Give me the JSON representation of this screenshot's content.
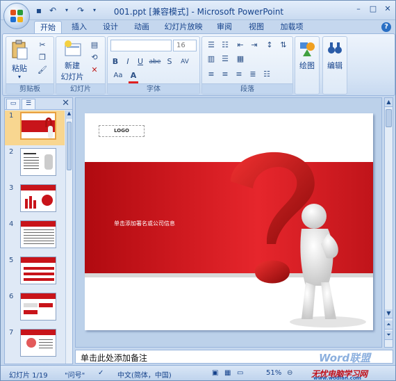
{
  "window": {
    "title": "001.ppt [兼容模式] - Microsoft PowerPoint"
  },
  "qat": [
    "save-icon",
    "undo-icon",
    "dropdown-icon",
    "redo-icon",
    "customize-icon"
  ],
  "tabs": [
    "开始",
    "插入",
    "设计",
    "动画",
    "幻灯片放映",
    "审阅",
    "视图",
    "加载项"
  ],
  "active_tab": "开始",
  "ribbon": {
    "clipboard": {
      "label": "剪贴板",
      "paste": "粘贴"
    },
    "slides": {
      "label": "幻灯片",
      "new_slide_1": "新建",
      "new_slide_2": "幻灯片"
    },
    "font": {
      "label": "字体",
      "size": "16",
      "bold": "B",
      "italic": "I",
      "underline": "U",
      "strike": "abe",
      "shadow": "S",
      "spacing": "AV",
      "case": "Aa",
      "color": "A"
    },
    "paragraph": {
      "label": "段落"
    },
    "drawing": {
      "label": "绘图"
    },
    "editing": {
      "label": "编辑"
    }
  },
  "thumbnails": [
    "1",
    "2",
    "3",
    "4",
    "5",
    "6",
    "7"
  ],
  "slide": {
    "logo": "LOGO",
    "subtitle": "单击添加署名或公司信息"
  },
  "notes": {
    "placeholder": "单击此处添加备注",
    "watermark": "Word联盟"
  },
  "status": {
    "slide_info": "幻灯片 1/19",
    "theme": "\"问号\"",
    "language": "中文(简体，中国)",
    "zoom": "51%",
    "watermark1": "无忧电脑学习网",
    "watermark2": "www.wodian.com"
  }
}
